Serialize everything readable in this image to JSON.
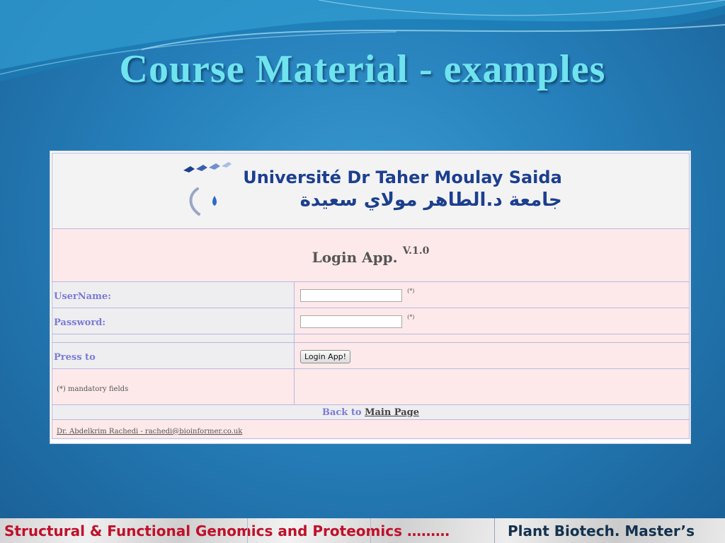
{
  "slide": {
    "title": "Course Material - examples"
  },
  "logo": {
    "french": "Université Dr Taher Moulay Saida",
    "arabic": "جامعة د.الطاهر مولاي سعيدة"
  },
  "login": {
    "app_title": "Login App.",
    "app_version": "V.1.0",
    "username_label": "UserName:",
    "username_value": "",
    "password_label": "Password:",
    "password_value": "",
    "required_marker": "(*)",
    "press_label": "Press to",
    "button_label": "Login App!",
    "mandatory_note": "(*) mandatory fields",
    "back_prefix": "Back to",
    "back_link": "Main Page",
    "author_link": "Dr. Abdelkrim Rachedi - rachedi@bioinformer.co.uk"
  },
  "footer": {
    "course": "Structural & Functional Genomics and Proteomics ………",
    "program": "Plant Biotech. Master’s"
  },
  "colors": {
    "title": "#6fe3ee",
    "label": "#7b7bd6",
    "course_text": "#c0102a",
    "program_text": "#13324e"
  }
}
